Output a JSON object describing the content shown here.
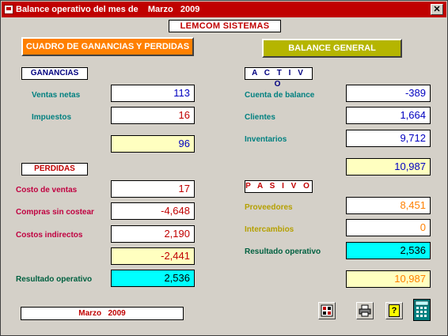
{
  "window": {
    "title": "Balance operativo del mes de    Marzo   2009",
    "close": "✕"
  },
  "company": "LEMCOM SISTEMAS",
  "buttons": {
    "ganancias": "CUADRO DE GANANCIAS Y PERDIDAS",
    "balance": "BALANCE GENERAL"
  },
  "ganancias": {
    "title": "GANANCIAS",
    "ventas_label": "Ventas netas",
    "ventas": "113",
    "impuestos_label": "Impuestos",
    "impuestos": "16",
    "subtotal": "96"
  },
  "perdidas": {
    "title": "PERDIDAS",
    "costo_label": "Costo de ventas",
    "costo": "17",
    "compras_label": "Compras sin costear",
    "compras": "-4,648",
    "indirectos_label": "Costos indirectos",
    "indirectos": "2,190",
    "subtotal": "-2,441"
  },
  "resultado_left": {
    "label": "Resultado operativo",
    "value": "2,536"
  },
  "activo": {
    "title": "A C T I V O",
    "cuenta_label": "Cuenta de balance",
    "cuenta": "-389",
    "clientes_label": "Clientes",
    "clientes": "1,664",
    "inventarios_label": "Inventarios",
    "inventarios": "9,712",
    "total": "10,987"
  },
  "pasivo": {
    "title": "P A S I V O",
    "proveedores_label": "Proveedores",
    "proveedores": "8,451",
    "intercambios_label": "Intercambios",
    "intercambios": "0",
    "resultado_label": "Resultado operativo",
    "resultado": "2,536",
    "total": "10,987"
  },
  "period": "Marzo   2009",
  "toolbar": {
    "icons": [
      "export-icon",
      "printer-icon",
      "help-icon",
      "calculator-icon"
    ],
    "help_glyph": "?"
  },
  "colors": {
    "titlebar": "#c00000",
    "orange_button": "#ff8000",
    "olive_button": "#b5b500",
    "cyan_field": "#00ffff",
    "yellow_field": "#ffffc0"
  }
}
